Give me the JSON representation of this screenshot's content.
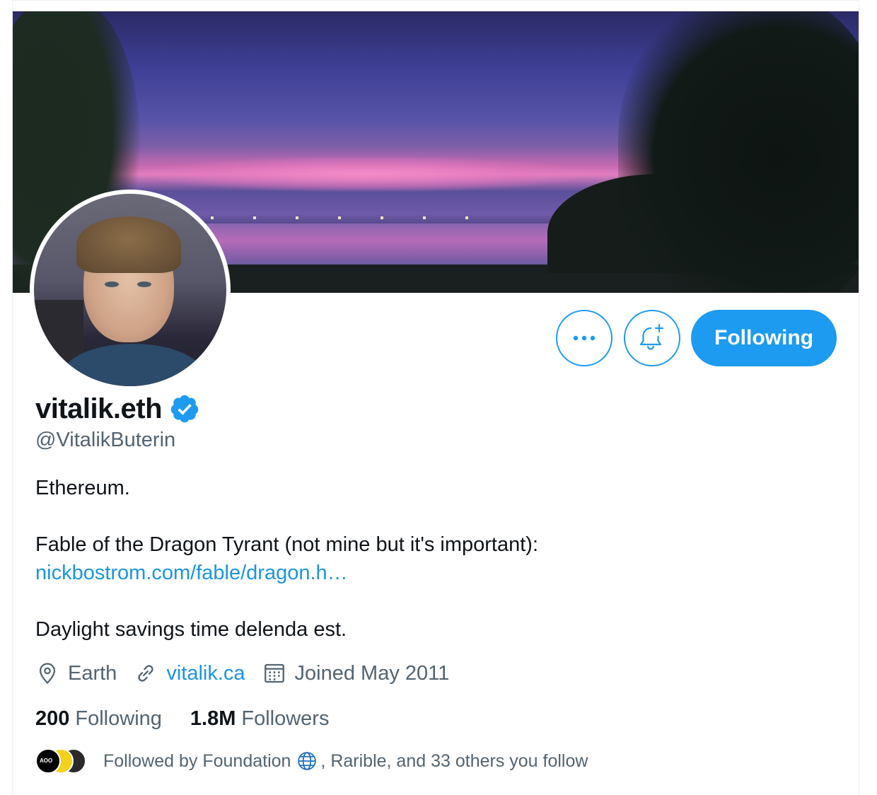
{
  "profile": {
    "display_name": "vitalik.eth",
    "handle": "@VitalikButerin",
    "verified": true
  },
  "actions": {
    "more_label": "More",
    "notify_label": "Turn on notifications",
    "following_label": "Following"
  },
  "bio": {
    "line1": "Ethereum.",
    "line2": "Fable of the Dragon Tyrant (not mine but it's important):",
    "link": "nickbostrom.com/fable/dragon.h…",
    "line3": "Daylight savings time delenda est."
  },
  "meta": {
    "location": "Earth",
    "website": "vitalik.ca",
    "joined": "Joined May 2011"
  },
  "stats": {
    "following_count": "200",
    "following_label": "Following",
    "followers_count": "1.8M",
    "followers_label": "Followers"
  },
  "followed_by": {
    "prefix": "Followed by Foundation",
    "suffix": ", Rarible, and 33 others you follow"
  },
  "colors": {
    "accent": "#1d9bf0",
    "text_primary": "#0f1419",
    "text_secondary": "#536471",
    "link": "#1b95e0"
  },
  "icons": {
    "more": "more-dots-icon",
    "notify": "bell-plus-icon",
    "verified": "verified-badge-icon",
    "location": "location-pin-icon",
    "website": "link-icon",
    "joined": "calendar-icon",
    "globe": "globe-icon"
  }
}
